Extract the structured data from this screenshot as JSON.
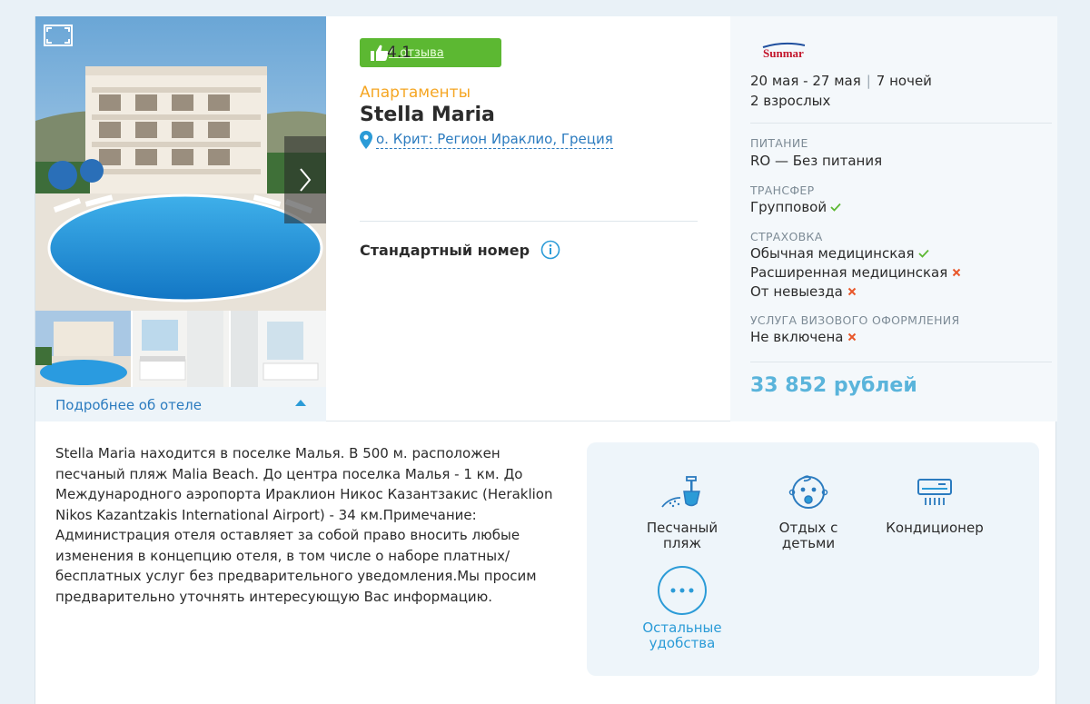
{
  "rating": {
    "value": "4.1",
    "reviews_label": "4 отзыва"
  },
  "hotel": {
    "type": "Апартаменты",
    "name": "Stella Maria",
    "location": "о. Крит: Регион Ираклио, Греция",
    "room": "Стандартный номер",
    "details_link": "Подробнее об отеле"
  },
  "operator": {
    "logo_text": "Sunmar"
  },
  "tour": {
    "dates": "20 мая - 27 мая",
    "separator": "|",
    "nights": "7 ночей",
    "pax": "2 взрослых"
  },
  "meals": {
    "label": "ПИТАНИЕ",
    "value": "RO — Без питания"
  },
  "transfer": {
    "label": "ТРАНСФЕР",
    "value": "Групповой",
    "included": true
  },
  "insurance": {
    "label": "СТРАХОВКА",
    "items": [
      {
        "name": "Обычная медицинская",
        "included": true
      },
      {
        "name": "Расширенная медицинская",
        "included": false
      },
      {
        "name": "От невыезда",
        "included": false
      }
    ]
  },
  "visa": {
    "label": "УСЛУГА ВИЗОВОГО ОФОРМЛЕНИЯ",
    "value": "Не включена",
    "included": false
  },
  "price": "33 852 рублей",
  "description": "Stella Maria находится в поселке Малья. В 500 м. расположен песчаный пляж Malia Beach. До центра поселка Малья - 1 км. До Международного аэропорта Ираклион Никос Казантзакис (Heraklion Nikos Kazantzakis International Airport) - 34 км.Примечание: Администрация отеля оставляет за собой право вносить любые изменения в концепцию отеля, в том числе о наборе платных/бесплатных услуг без предварительного уведомления.Мы просим предварительно уточнять интересующую Вас информацию.",
  "amenities": {
    "beach": "Песчаный пляж",
    "kids": "Отдых с детьми",
    "ac": "Кондиционер",
    "more": "Остальные удобства"
  },
  "colors": {
    "accent": "#2b9bd7",
    "rating_green": "#5cb832",
    "type_orange": "#f5a623",
    "price_blue": "#5ab4db",
    "cross_red": "#e8572a"
  }
}
